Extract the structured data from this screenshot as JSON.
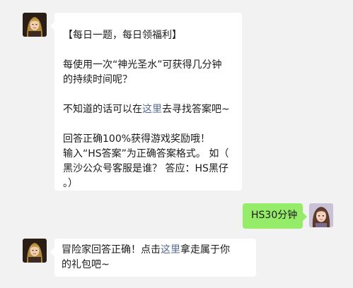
{
  "messages": {
    "question": {
      "title": "【每日一题，每日领福利】",
      "question_line1": "每使用一次“神光圣水”可获得几分钟",
      "question_line2": "的持续时间呢？",
      "hint_prefix": "不知道的话可以在",
      "hint_link": "这里",
      "hint_suffix": "去寻找答案吧~",
      "reward_line": "回答正确100%获得游戏奖励哦！",
      "format_line1": "输入“HS答案”为正确答案格式。 如（",
      "format_line2": "黑沙公众号客服是谁？ 答应：HS黑仔",
      "format_line3": "。）"
    },
    "answer": {
      "text": "HS30分钟"
    },
    "reply": {
      "line1_prefix": "冒险家回答正确！点击",
      "line1_link": "这里",
      "line1_suffix": "拿走属于你",
      "line2": "的礼包吧~"
    }
  },
  "colors": {
    "background": "#f2f2f2",
    "bubble_incoming": "#ffffff",
    "bubble_outgoing": "#95ec69",
    "link": "#576b95"
  }
}
